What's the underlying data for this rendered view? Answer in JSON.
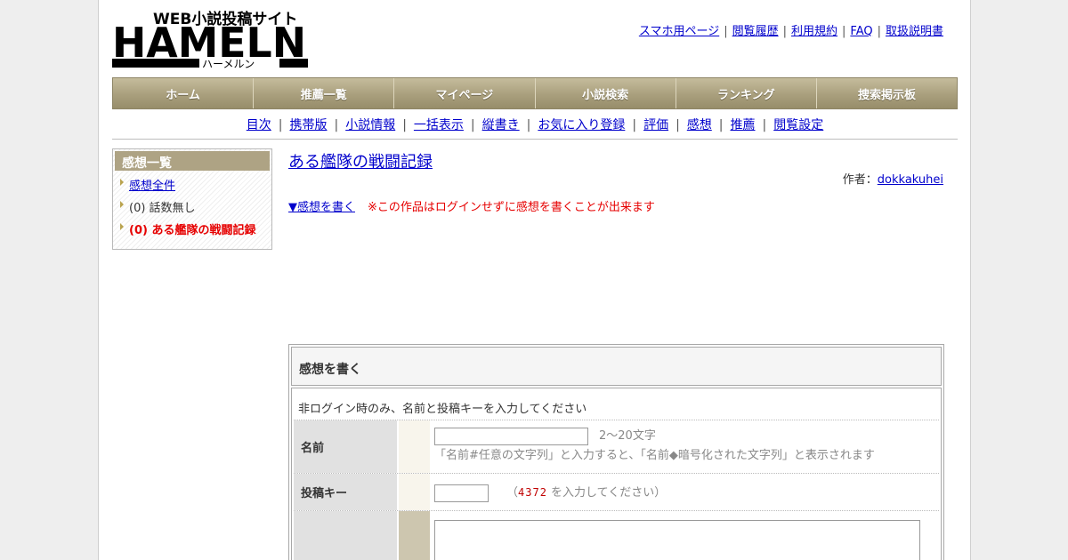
{
  "logo": {
    "tagline": "WEB小説投稿サイト",
    "wordmark": "HAMELN",
    "kana": "ハーメルン"
  },
  "top_links": [
    "スマホ用ページ",
    "閲覧履歴",
    "利用規約",
    "FAQ",
    "取扱説明書"
  ],
  "nav": [
    "ホーム",
    "推薦一覧",
    "マイページ",
    "小説検索",
    "ランキング",
    "捜索掲示板"
  ],
  "sub_links": [
    "目次",
    "携帯版",
    "小説情報",
    "一括表示",
    "縦書き",
    "お気に入り登録",
    "評価",
    "感想",
    "推薦",
    "閲覧設定"
  ],
  "sidebar": {
    "title": "感想一覧",
    "items": [
      {
        "label": "感想全件",
        "link": true
      },
      {
        "label": "(0) 話数無し",
        "link": false
      },
      {
        "label": "(0) ある艦隊の戦闘記録",
        "active": true
      }
    ]
  },
  "main": {
    "title": "ある艦隊の戦闘記録",
    "author_label": "作者：",
    "author": "dokkakuhei",
    "write_link": "▼感想を書く",
    "write_note": "※この作品はログインせずに感想を書くことが出来ます"
  },
  "form": {
    "heading": "感想を書く",
    "note": "非ログイン時のみ、名前と投稿キーを入力してください",
    "name_label": "名前",
    "name_hint": "2～20文字",
    "name_desc": "「名前#任意の文字列」と入力すると、「名前◆暗号化された文字列」と表示されます",
    "key_label": "投稿キー",
    "key_prefix": "（",
    "key_code": "4372",
    "key_suffix": " を入力してください）"
  },
  "colors": {
    "link": "#0000cc",
    "alert": "#e60000",
    "nav": "#a99f7d"
  }
}
